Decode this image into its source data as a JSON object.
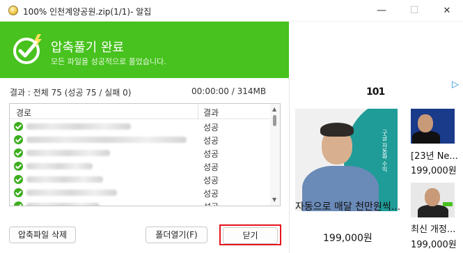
{
  "window": {
    "title": "100% 인천계양공원.zip(1/1)- 알집",
    "minimize_glyph": "—",
    "maximize_glyph": "☐",
    "close_glyph": "✕",
    "app_icon": "alzip-acorn-icon"
  },
  "header": {
    "title": "압축풀기 완료",
    "subtitle": "모든 파일을 성공적으로 풀었습니다.",
    "icon": "check-circle-icon",
    "background_color": "#47c21e"
  },
  "summary": {
    "result_text": "결과 : 전체 75 (성공 75 / 실패 0)",
    "time_size_text": "00:00:00 / 314MB"
  },
  "file_list": {
    "columns": {
      "path": "경로",
      "result": "결과"
    },
    "rows": [
      {
        "status": "성공",
        "icon": "success-check-icon"
      },
      {
        "status": "성공",
        "icon": "success-check-icon"
      },
      {
        "status": "성공",
        "icon": "success-check-icon"
      },
      {
        "status": "성공",
        "icon": "success-check-icon"
      },
      {
        "status": "성공",
        "icon": "success-check-icon"
      },
      {
        "status": "성공",
        "icon": "success-check-icon"
      },
      {
        "status": "성공",
        "icon": "success-check-icon"
      }
    ]
  },
  "buttons": {
    "delete_archive": "압축파일 삭제",
    "open_folder": "폴더열기(F)",
    "close": "닫기",
    "highlight_color": "#e4141c"
  },
  "ad": {
    "logo": "101",
    "choices_icon": "ad-choices-icon",
    "items": [
      {
        "title": "자동으로 매달 천만원씩...",
        "price": "199,000원",
        "image_text": "구글 자동화 수익"
      },
      {
        "title": "[23년 Ne...",
        "price": "199,000원"
      },
      {
        "title": "최신 개정...",
        "price": "199,000원"
      }
    ]
  }
}
